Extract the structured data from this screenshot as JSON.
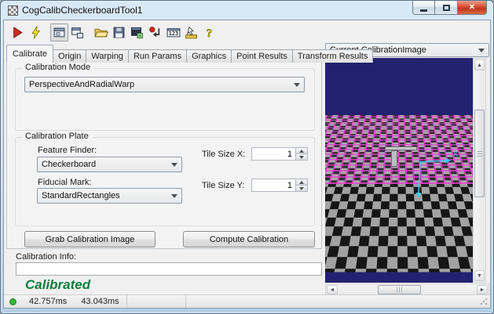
{
  "window": {
    "title": "CogCalibCheckerboardTool1",
    "caption_buttons": [
      "minimize",
      "maximize",
      "close"
    ]
  },
  "toolbar": {
    "icons": [
      "run-icon",
      "lightning-icon",
      "image-display-icon",
      "float-display-icon",
      "open-folder-icon",
      "save-icon",
      "save-image-icon",
      "reset-icon",
      "results-123-icon",
      "position-ruler-icon",
      "help-icon"
    ],
    "results_icon_label": "123",
    "help_icon_label": "?"
  },
  "tabs": {
    "active": "Calibrate",
    "items": [
      {
        "label": "Calibrate"
      },
      {
        "label": "Origin"
      },
      {
        "label": "Warping"
      },
      {
        "label": "Run Params"
      },
      {
        "label": "Graphics"
      },
      {
        "label": "Point Results"
      },
      {
        "label": "Transform Results"
      }
    ]
  },
  "calibration_mode": {
    "title": "Calibration Mode",
    "value": "PerspectiveAndRadialWarp"
  },
  "calibration_plate": {
    "title": "Calibration Plate",
    "feature_finder": {
      "label": "Feature Finder:",
      "value": "Checkerboard"
    },
    "fiducial_mark": {
      "label": "Fiducial Mark:",
      "value": "StandardRectangles"
    },
    "tile_size_x": {
      "label": "Tile Size X:",
      "value": "1"
    },
    "tile_size_y": {
      "label": "Tile Size Y:",
      "value": "1"
    }
  },
  "actions": {
    "grab": "Grab Calibration Image",
    "compute": "Compute Calibration"
  },
  "calibration_info": {
    "label": "Calibration Info:",
    "value": "",
    "status_text": "Calibrated"
  },
  "image_panel": {
    "selected_image": "Current.CalibrationImage",
    "x_axis_label": "X"
  },
  "status_bar": {
    "durations": [
      "42.757ms",
      "43.043ms"
    ]
  },
  "colors": {
    "image_background": "#232270",
    "overlay_magenta": "#e83ed6",
    "axis_cyan": "#3ec8ee",
    "status_green_text": "#0f7c40",
    "indicator_green": "#35b535"
  }
}
